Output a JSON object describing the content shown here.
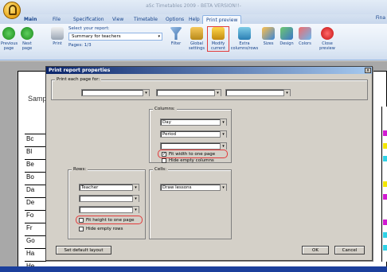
{
  "window": {
    "title": "aSc Timetables 2009 - BETA VERSION!!-"
  },
  "menu": {
    "tabs": [
      "Main",
      "File",
      "Specification",
      "View",
      "Timetable",
      "Options",
      "Help",
      "Print preview"
    ],
    "right_label": "Fina"
  },
  "ribbon": {
    "previous_page": "Previous page",
    "next_page": "Next page",
    "print": "Print",
    "select_report_label": "Select your report:",
    "report_value": "Summary for teachers",
    "pages": "Pages: 1/3",
    "filter": "Filter",
    "global_settings": "Global settings",
    "modify_current": "Modify current",
    "extra_columns_rows": "Extra columns/rows",
    "sizes": "Sizes",
    "design": "Design",
    "colors": "Colors",
    "close_preview": "Close preview"
  },
  "preview": {
    "sample": "Sample",
    "row_labels": [
      "Bc",
      "Bl",
      "Be",
      "Bo",
      "Da",
      "De",
      "Fo",
      "Fr",
      "Go",
      "Ha",
      "He",
      "Hi"
    ]
  },
  "dialog": {
    "title": "Print report properties",
    "close_glyph": "x",
    "print_each_page_for": "Print each page for:",
    "columns_label": "Columns:",
    "columns": [
      "Day",
      "Period",
      ""
    ],
    "fit_width": "Fit width to one page",
    "fit_width_checked": true,
    "hide_empty_columns": "Hide empty columns",
    "rows_label": "Rows:",
    "rows": [
      "Teacher",
      "",
      ""
    ],
    "fit_height": "Fit height to one page",
    "hide_empty_rows": "Hide empty rows",
    "cells_label": "Cells:",
    "cells_value": "Draw lessons",
    "set_default_layout": "Set default layout",
    "ok": "OK",
    "cancel": "Cancel"
  },
  "colors": {
    "accent": "#15428b",
    "highlight": "#e23b3b",
    "dialog_bg": "#d4d0c8",
    "taskbar": "#1b3f9c"
  }
}
